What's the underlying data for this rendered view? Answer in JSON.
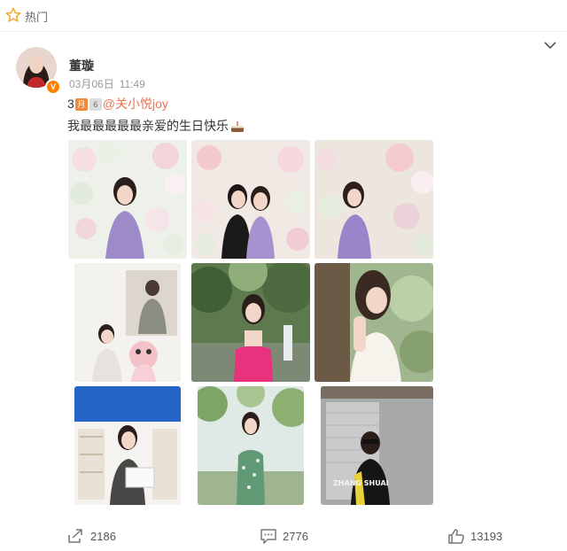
{
  "header": {
    "hot_label": "热门"
  },
  "post": {
    "author": "董璇",
    "date": "03月06日",
    "time": "11:49",
    "line1_prefix": "3",
    "line1_cal1": "月",
    "line1_cal2": "6",
    "mention": "@关小悦joy",
    "text": "我最最最最最亲爱的生日快乐",
    "photo_watermark": "ZHANG SHUAI"
  },
  "footer": {
    "repost_count": "2186",
    "comment_count": "2776",
    "like_count": "13193"
  },
  "colors": {
    "accent": "#eb7350",
    "verify": "#ff8200"
  },
  "icons": [
    "star-icon",
    "chevron-down-icon",
    "repost-icon",
    "comment-icon",
    "like-icon"
  ]
}
